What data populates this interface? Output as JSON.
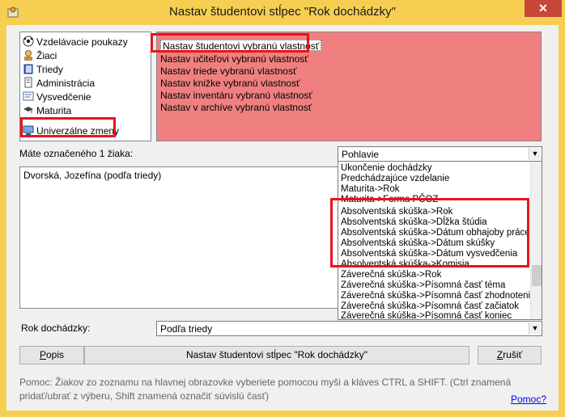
{
  "window": {
    "title": "Nastav študentovi stĺpec \"Rok dochádzky\"",
    "close_glyph": "✕"
  },
  "nav": {
    "items": [
      {
        "label": "Vzdelávacie poukazy",
        "icon": "soccer-ball-icon"
      },
      {
        "label": "Žiaci",
        "icon": "student-icon"
      },
      {
        "label": "Triedy",
        "icon": "book-icon"
      },
      {
        "label": "Administrácia",
        "icon": "document-icon"
      },
      {
        "label": "Vysvedčenie",
        "icon": "certificate-icon"
      },
      {
        "label": "Maturita",
        "icon": "graduation-icon"
      },
      {
        "label": "Univerzálne zmeny",
        "icon": "computer-icon"
      }
    ]
  },
  "properties": {
    "items": [
      "Nastav študentovi vybranú vlastnosť",
      "Nastav učiteľovi vybranú vlastnosť",
      "Nastav triede vybranú vlastnosť",
      "Nastav knižke vybranú vlastnosť",
      "Nastav inventáru vybranú vlastnosť",
      "Nastav v archíve vybranú vlastnosť"
    ]
  },
  "count_label": "Máte označeného 1 žiaka:",
  "attribute_select": {
    "value": "Pohlavie"
  },
  "attribute_options": [
    "Ukončenie dochádzky",
    "Predchádzajúce vzdelanie",
    "Maturita->Rok",
    "Maturita->Forma PČOZ",
    "Absolventská skúška->Rok",
    "Absolventská skúška->Dĺžka štúdia",
    "Absolventská skúška->Dátum obhajoby práce",
    "Absolventská skúška->Dátum skúšky",
    "Absolventská skúška->Dátum vysvedčenia",
    "Absolventská skúška->Komisia",
    "Záverečná skúška->Rok",
    "Záverečná skúška->Písomná časť téma",
    "Záverečná skúška->Písomná časť zhodnotenie",
    "Záverečná skúška->Písomná časť začiatok",
    "Záverečná skúška->Písomná časť koniec"
  ],
  "students": {
    "row": "Dvorská, Jozefína (podľa triedy)"
  },
  "rok": {
    "label": "Rok dochádzky:",
    "value": "Podľa triedy"
  },
  "buttons": {
    "popis_first": "P",
    "popis_rest": "opis",
    "nastav": "Nastav študentovi stĺpec \"Rok dochádzky\"",
    "zrusit_first": "Z",
    "zrusit_rest": "rušiť"
  },
  "help": {
    "text": "Pomoc: Žiakov zo zoznamu na hlavnej obrazovke vyberiete pomocou myši a kláves CTRL a SHIFT. (Ctrl znamená pridať/ubrať z výberu, Shift znamená označiť súvislú časť)",
    "link": "Pomoc?"
  },
  "colors": {
    "accent": "#f6cf52",
    "properties_bg": "#f08080",
    "highlight": "#e8141c"
  }
}
